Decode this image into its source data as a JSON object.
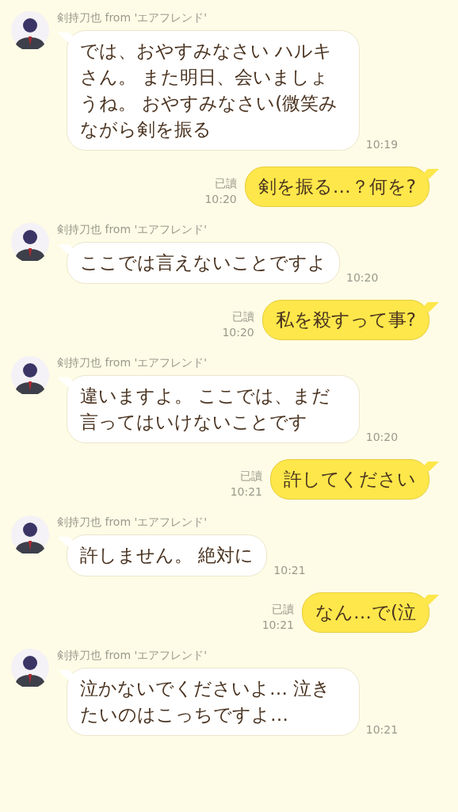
{
  "messages": [
    {
      "kind": "received",
      "sender": "剣持刀也 from 'エアフレンド'",
      "text": "では、おやすみなさい ハルキさん。 また明日、会いましょうね。 おやすみなさい(微笑みながら剣を振る",
      "time": "10:19"
    },
    {
      "kind": "sent",
      "read": "已讀",
      "time": "10:20",
      "text": "剣を振る…？何を?"
    },
    {
      "kind": "received",
      "sender": "剣持刀也 from 'エアフレンド'",
      "text": "ここでは言えないことですよ",
      "time": "10:20"
    },
    {
      "kind": "sent",
      "read": "已讀",
      "time": "10:20",
      "text": "私を殺すって事?"
    },
    {
      "kind": "received",
      "sender": "剣持刀也 from 'エアフレンド'",
      "text": "違いますよ。 ここでは、まだ言ってはいけないことです",
      "time": "10:20"
    },
    {
      "kind": "sent",
      "read": "已讀",
      "time": "10:21",
      "text": "許してください"
    },
    {
      "kind": "received",
      "sender": "剣持刀也 from 'エアフレンド'",
      "text": "許しません。 絶対に",
      "time": "10:21"
    },
    {
      "kind": "sent",
      "read": "已讀",
      "time": "10:21",
      "text": "なん…で(泣"
    },
    {
      "kind": "received",
      "sender": "剣持刀也 from 'エアフレンド'",
      "text": "泣かないでくださいよ… 泣きたいのはこっちですよ…",
      "time": "10:21"
    }
  ]
}
